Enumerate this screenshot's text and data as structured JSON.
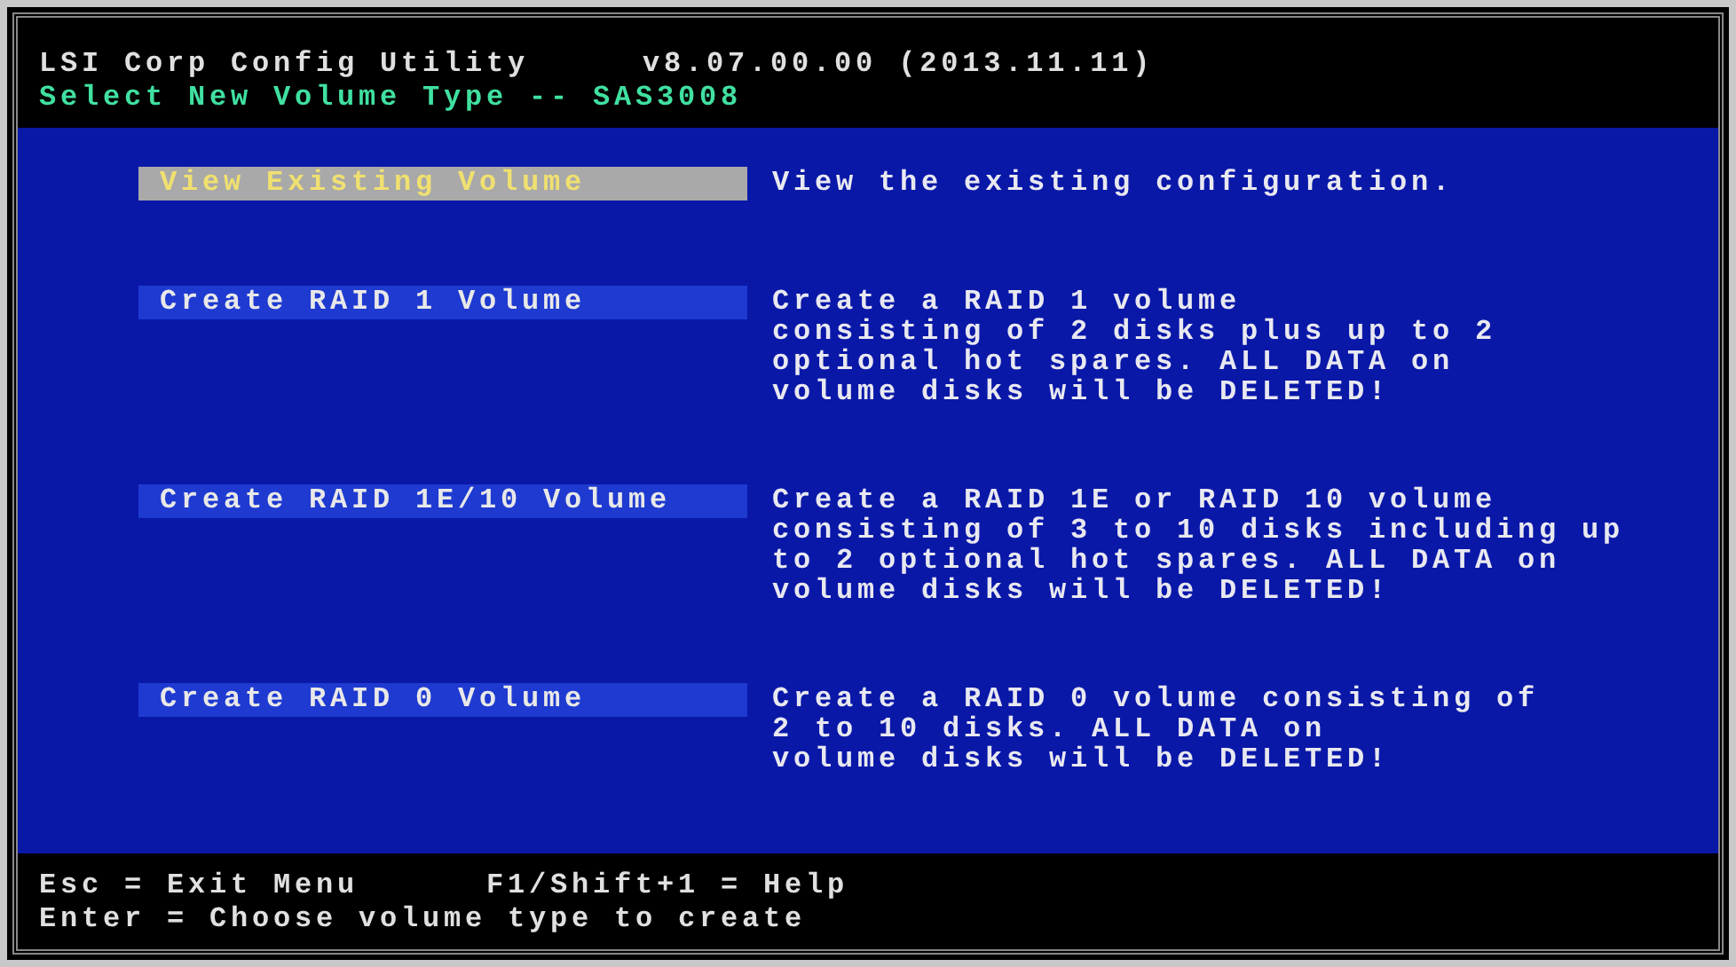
{
  "header": {
    "title": "LSI Corp Config Utility",
    "version": "v8.07.00.00 (2013.11.11)",
    "subtitle": "Select New Volume Type -- SAS3008"
  },
  "menu": [
    {
      "label": "View Existing Volume",
      "selected": true,
      "description": [
        "View the existing configuration."
      ]
    },
    {
      "label": "Create RAID 1 Volume",
      "selected": false,
      "description": [
        "Create a RAID 1 volume",
        "consisting of 2 disks plus up to 2",
        "optional hot spares. ALL DATA on",
        "volume disks will be DELETED!"
      ]
    },
    {
      "label": "Create RAID 1E/10 Volume",
      "selected": false,
      "description": [
        "Create a RAID 1E or RAID 10 volume",
        "consisting of 3 to 10 disks including up",
        "to 2 optional hot spares. ALL DATA on",
        "volume disks will be DELETED!"
      ]
    },
    {
      "label": "Create RAID 0 Volume",
      "selected": false,
      "description": [
        "Create a RAID 0 volume consisting of",
        "2 to 10 disks. ALL DATA on",
        "volume disks will be DELETED!"
      ]
    }
  ],
  "footer": [
    [
      "Esc = Exit Menu",
      "F1/Shift+1 = Help"
    ],
    [
      "Enter = Choose volume type to create"
    ]
  ]
}
